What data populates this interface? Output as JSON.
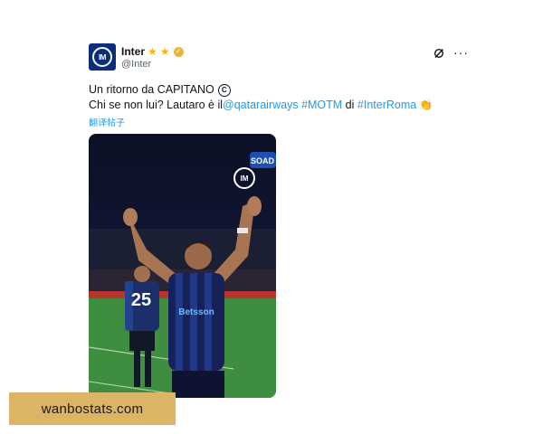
{
  "tweet": {
    "author": {
      "display_name": "Inter",
      "handle": "@Inter",
      "avatar_logo": "IM",
      "badges": [
        "star-icon",
        "star-icon",
        "verified-gold-icon"
      ]
    },
    "text_line1": "Un ritorno da CAPITANO",
    "text_line2_prefix": "Chi se non lui? Lautaro è il ",
    "mention": "@qatarairways",
    "hashtag_motm": "#MOTM",
    "connector": " di ",
    "hashtag_team": "#InterRoma",
    "translate_label": "翻译帖子",
    "actions": [
      "grok-icon",
      "more-icon"
    ],
    "media": {
      "jersey_number_player": "",
      "jersey_number_background": "25",
      "sponsor_text": "Betsson",
      "corner_logo_text": "SOAD"
    }
  },
  "watermark": {
    "text": "wanbostats.com"
  },
  "colors": {
    "link": "#1d9bf0",
    "text": "#0f1419",
    "secondary": "#536471",
    "avatar_bg": "#0b2d7a",
    "watermark_bg": "#dcb466"
  }
}
